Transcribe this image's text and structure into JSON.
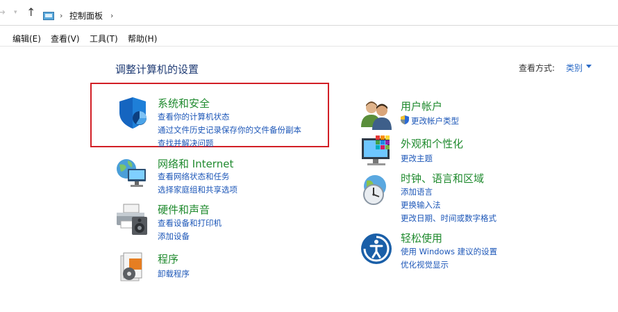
{
  "address_bar": {
    "breadcrumb": "控制面板",
    "icons": [
      "back-arrow-icon",
      "recent-dropdown-icon",
      "up-arrow-icon",
      "control-panel-icon"
    ]
  },
  "menu": {
    "items": [
      {
        "label": "编辑(E)"
      },
      {
        "label": "查看(V)"
      },
      {
        "label": "工具(T)"
      },
      {
        "label": "帮助(H)"
      }
    ]
  },
  "header": {
    "title": "调整计算机的设置",
    "view_by_label": "查看方式:",
    "view_by_value": "类别"
  },
  "categories_left": [
    {
      "name": "系统和安全",
      "icon": "shield-icon",
      "links": [
        "查看你的计算机状态",
        "通过文件历史记录保存你的文件备份副本",
        "查找并解决问题"
      ]
    },
    {
      "name": "网络和 Internet",
      "icon": "network-globe-icon",
      "links": [
        "查看网络状态和任务",
        "选择家庭组和共享选项"
      ]
    },
    {
      "name": "硬件和声音",
      "icon": "printer-speaker-icon",
      "links": [
        "查看设备和打印机",
        "添加设备"
      ]
    },
    {
      "name": "程序",
      "icon": "programs-icon",
      "links": [
        "卸载程序"
      ]
    }
  ],
  "categories_right": [
    {
      "name": "用户帐户",
      "icon": "users-icon",
      "links": [
        "更改帐户类型"
      ]
    },
    {
      "name": "外观和个性化",
      "icon": "monitor-palette-icon",
      "links": [
        "更改主题"
      ]
    },
    {
      "name": "时钟、语言和区域",
      "icon": "clock-globe-icon",
      "links": [
        "添加语言",
        "更换输入法",
        "更改日期、时间或数字格式"
      ]
    },
    {
      "name": "轻松使用",
      "icon": "ease-of-access-icon",
      "links": [
        "使用 Windows 建议的设置",
        "优化视觉显示"
      ]
    }
  ],
  "colors": {
    "category_heading": "#1f8a2e",
    "link": "#1d57b8",
    "title": "#1f3b74",
    "highlight_box": "#d21f26"
  }
}
